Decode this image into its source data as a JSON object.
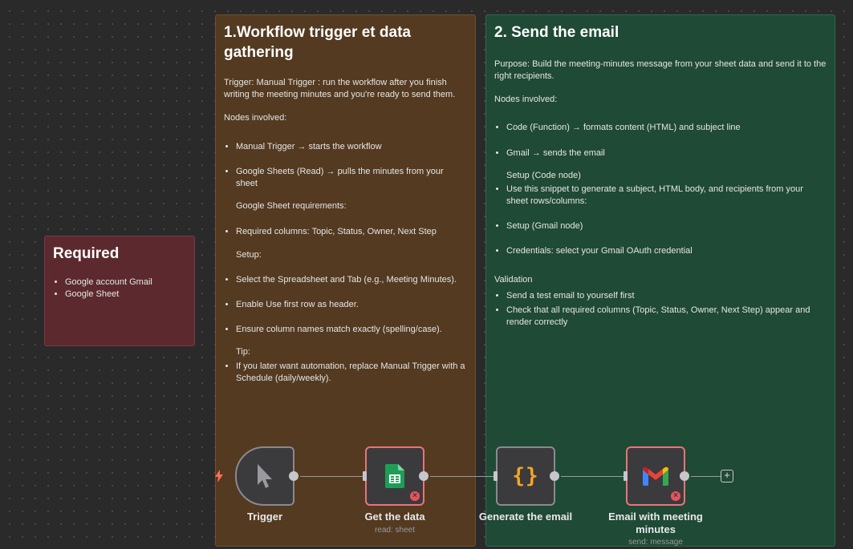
{
  "required": {
    "title": "Required",
    "items": [
      "Google account Gmail",
      "Google Sheet"
    ]
  },
  "section1": {
    "title": "1.Workflow trigger et data gathering",
    "trigger_text": "Trigger: Manual Trigger : run the workflow after you finish writing the meeting minutes and you're ready to send them.",
    "nodes_involved": "Nodes involved:",
    "item_manual": "Manual Trigger → starts the workflow",
    "item_sheets": "Google Sheets (Read) → pulls the minutes from your sheet",
    "sheet_requirements": "Google Sheet requirements:",
    "item_columns": "Required columns: Topic, Status, Owner, Next Step",
    "setup": "Setup:",
    "item_select": "Select the Spreadsheet and Tab (e.g., Meeting Minutes).",
    "item_header": "Enable Use first row as header.",
    "item_names": "Ensure column names match exactly (spelling/case).",
    "tip": "Tip:",
    "item_tip": "If you later want automation, replace Manual Trigger with a Schedule (daily/weekly)."
  },
  "section2": {
    "title": "2. Send the email",
    "purpose": "Purpose: Build the meeting-minutes message from your sheet data and send it to the right recipients.",
    "nodes_involved": "Nodes involved:",
    "item_code": "Code (Function) → formats content (HTML) and subject line",
    "item_gmail": "Gmail → sends the email",
    "setup_code": "Setup (Code node)",
    "item_snippet": "Use this snippet to generate a subject, HTML body, and recipients from your sheet rows/columns:",
    "item_setup_gmail": "Setup (Gmail node)",
    "item_credentials": "Credentials: select your Gmail OAuth credential",
    "validation": "Validation",
    "item_test": "Send a test email to yourself first",
    "item_check": "Check that all required columns (Topic, Status, Owner, Next Step) appear and render correctly"
  },
  "nodes": {
    "trigger": {
      "label": "Trigger",
      "icon": "cursor-pointer-icon"
    },
    "get_data": {
      "label": "Get the data",
      "sub": "read: sheet",
      "icon": "google-sheets-icon"
    },
    "generate": {
      "label": "Generate the email",
      "icon": "code-braces-icon",
      "icon_text": "{}"
    },
    "email": {
      "label": "Email with meeting minutes",
      "sub": "send: message",
      "icon": "gmail-icon"
    }
  },
  "colors": {
    "canvas": "#2a2a2b",
    "required_note": "#5c2a2e",
    "section1_note": "#533a20",
    "section2_note": "#1f4a35",
    "error_border": "#e8747c",
    "trigger_bolt": "#ff6d5a",
    "braces": "#f5a623"
  }
}
